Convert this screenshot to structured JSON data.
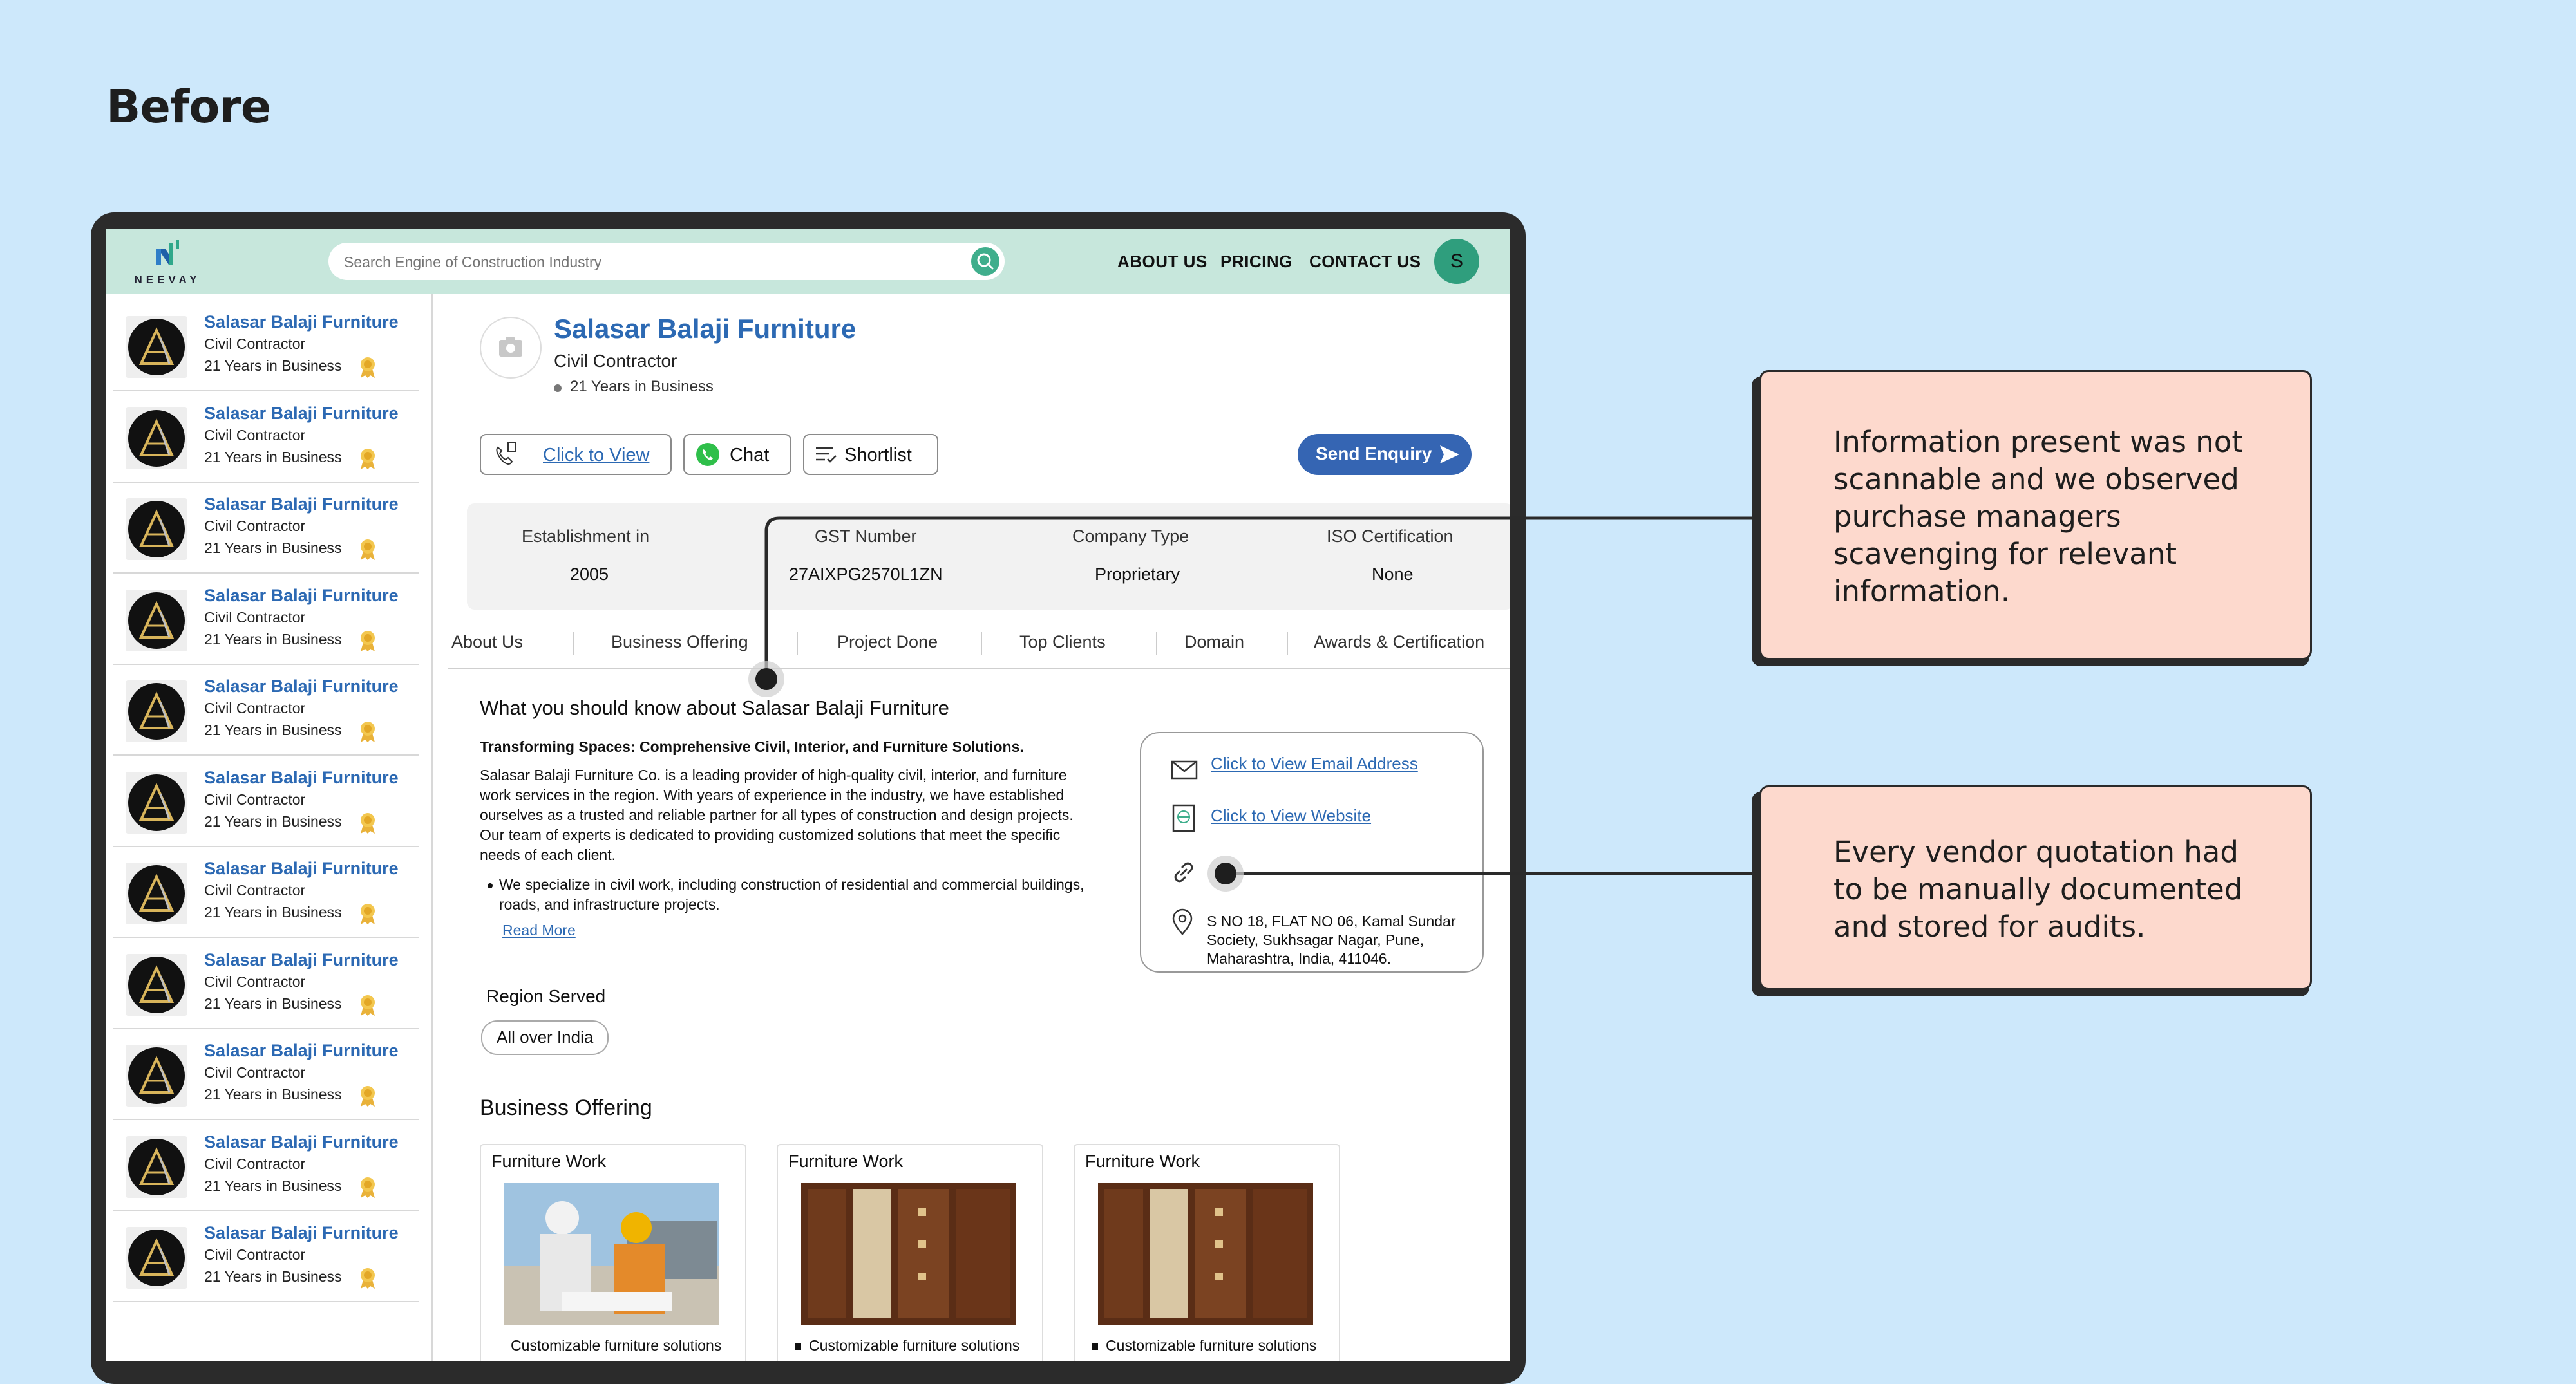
{
  "heading": "Before",
  "topbar": {
    "logo_text": "NEEVAY",
    "search_placeholder": "Search Engine of Construction Industry",
    "nav": [
      "ABOUT US",
      "PRICING",
      "CONTACT US"
    ],
    "avatar_initial": "S"
  },
  "sidebar": {
    "items": [
      {
        "name": "Salasar Balaji Furniture",
        "type": "Civil Contractor",
        "years": "21 Years in Business"
      },
      {
        "name": "Salasar Balaji Furniture",
        "type": "Civil Contractor",
        "years": "21 Years in Business"
      },
      {
        "name": "Salasar Balaji Furniture",
        "type": "Civil Contractor",
        "years": "21 Years in Business"
      },
      {
        "name": "Salasar Balaji Furniture",
        "type": "Civil Contractor",
        "years": "21 Years in Business"
      },
      {
        "name": "Salasar Balaji Furniture",
        "type": "Civil Contractor",
        "years": "21 Years in Business"
      },
      {
        "name": "Salasar Balaji Furniture",
        "type": "Civil Contractor",
        "years": "21 Years in Business"
      },
      {
        "name": "Salasar Balaji Furniture",
        "type": "Civil Contractor",
        "years": "21 Years in Business"
      },
      {
        "name": "Salasar Balaji Furniture",
        "type": "Civil Contractor",
        "years": "21 Years in Business"
      },
      {
        "name": "Salasar Balaji Furniture",
        "type": "Civil Contractor",
        "years": "21 Years in Business"
      },
      {
        "name": "Salasar Balaji Furniture",
        "type": "Civil Contractor",
        "years": "21 Years in Business"
      },
      {
        "name": "Salasar Balaji Furniture",
        "type": "Civil Contractor",
        "years": "21 Years in Business"
      }
    ]
  },
  "profile": {
    "name": "Salasar Balaji Furniture",
    "type": "Civil Contractor",
    "years": "21 Years in Business"
  },
  "actions": {
    "click_to_view": "Click to View",
    "chat": "Chat",
    "shortlist": "Shortlist",
    "send_enquiry": "Send Enquiry"
  },
  "facts": [
    {
      "label": "Establishment in",
      "value": "2005"
    },
    {
      "label": "GST Number",
      "value": "27AIXPG2570L1ZN"
    },
    {
      "label": "Company Type",
      "value": "Proprietary"
    },
    {
      "label": "ISO Certification",
      "value": "None"
    }
  ],
  "tabs": [
    "About Us",
    "Business Offering",
    "Project Done",
    "Top Clients",
    "Domain",
    "Awards & Certification"
  ],
  "about": {
    "heading": "What you should know about Salasar Balaji Furniture",
    "subheading": "Transforming Spaces: Comprehensive Civil, Interior, and Furniture Solutions.",
    "paragraph": "Salasar Balaji Furniture Co. is a leading provider of high-quality civil, interior, and furniture work services in the region. With years of experience in the industry, we have established ourselves as a trusted and reliable partner for all types of construction and design projects. Our team of experts is dedicated to providing customized solutions that meet the specific needs of each client.",
    "bullet": "We specialize in civil work, including construction of residential and commercial buildings, roads, and infrastructure projects.",
    "read_more": "Read More"
  },
  "contact": {
    "email_link": "Click to View Email Address",
    "website_link": "Click to View Website",
    "address": "S NO 18, FLAT NO 06, Kamal Sundar Society, Sukhsagar Nagar, Pune, Maharashtra, India, 411046."
  },
  "region": {
    "label": "Region Served",
    "value": "All over India"
  },
  "business_offering": {
    "title": "Business Offering",
    "cards": [
      {
        "title": "Furniture Work",
        "caption": "Customizable furniture solutions"
      },
      {
        "title": "Furniture Work",
        "caption": "Customizable furniture solutions"
      },
      {
        "title": "Furniture Work",
        "caption": "Customizable furniture solutions"
      }
    ]
  },
  "callouts": [
    {
      "text": "Information present was not scannable and we observed purchase managers scavenging for relevant information."
    },
    {
      "text": "Every vendor quotation had to be manually documented and stored for audits."
    }
  ],
  "colors": {
    "background": "#cde8fb",
    "topbar": "#c7e7dc",
    "link_blue": "#2c69b3",
    "send_button": "#3565b3",
    "callout_fill": "#fdd9cd"
  }
}
